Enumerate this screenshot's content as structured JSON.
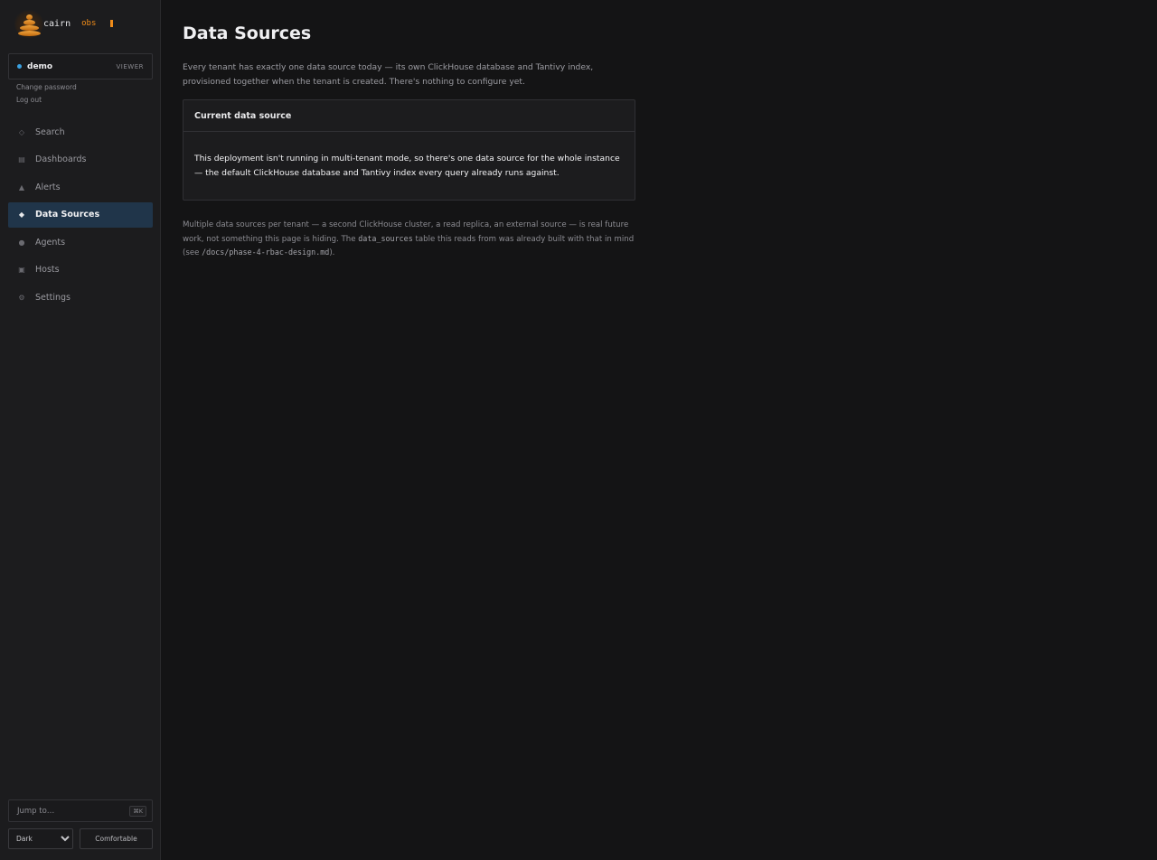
{
  "brand": {
    "name": "cairn",
    "tag": "obs"
  },
  "user": {
    "name": "demo",
    "role": "VIEWER"
  },
  "account": {
    "change_password": "Change password",
    "logout": "Log out"
  },
  "nav": {
    "items": [
      {
        "label": "Search",
        "icon": "diamond-outline-icon",
        "glyph": "◇"
      },
      {
        "label": "Dashboards",
        "icon": "dashboard-icon",
        "glyph": "▤"
      },
      {
        "label": "Alerts",
        "icon": "triangle-alert-icon",
        "glyph": "▲"
      },
      {
        "label": "Data Sources",
        "icon": "diamond-filled-icon",
        "glyph": "◆",
        "active": true
      },
      {
        "label": "Agents",
        "icon": "dot-icon",
        "glyph": "●"
      },
      {
        "label": "Hosts",
        "icon": "square-icon",
        "glyph": "▣"
      },
      {
        "label": "Settings",
        "icon": "gear-icon",
        "glyph": "⚙"
      }
    ]
  },
  "footer": {
    "jump_label": "Jump to…",
    "jump_shortcut": "⌘K",
    "theme_options": [
      "Dark"
    ],
    "theme_selected": "Dark",
    "density_label": "Comfortable"
  },
  "page": {
    "title": "Data Sources",
    "intro": "Every tenant has exactly one data source today — its own ClickHouse database and Tantivy index, provisioned together when the tenant is created. There's nothing to configure yet.",
    "panel_title": "Current data source",
    "panel_body": "This deployment isn't running in multi-tenant mode, so there's one data source for the whole instance — the default ClickHouse database and Tantivy index every query already runs against.",
    "footnote": {
      "part1": "Multiple data sources per tenant — a second ClickHouse cluster, a read replica, an external source — is real future work, not something this page is hiding. The ",
      "code1": "data_sources",
      "part2": " table this reads from was already built with that in mind (see ",
      "code2": "/docs/phase-4-rbac-design.md",
      "part3": ")."
    }
  },
  "colors": {
    "accent": "#f08c1a",
    "active_nav": "#20354a",
    "status_dot": "#3aa0e0",
    "background": "#141415",
    "sidebar": "#1c1c1e"
  }
}
